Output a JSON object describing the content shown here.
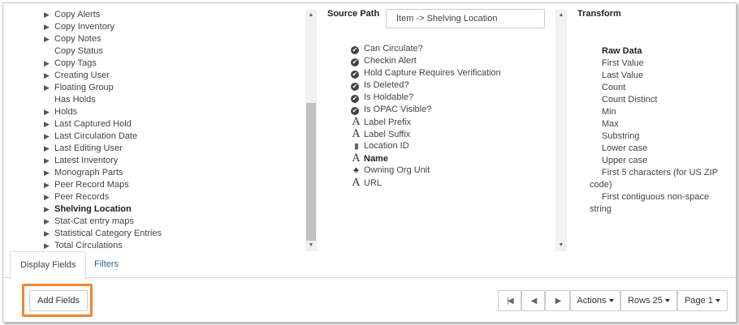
{
  "tree": {
    "items": [
      {
        "label": "Copy Alerts",
        "expandable": true
      },
      {
        "label": "Copy Inventory",
        "expandable": true
      },
      {
        "label": "Copy Notes",
        "expandable": true
      },
      {
        "label": "Copy Status",
        "expandable": false
      },
      {
        "label": "Copy Tags",
        "expandable": true
      },
      {
        "label": "Creating User",
        "expandable": true
      },
      {
        "label": "Floating Group",
        "expandable": true
      },
      {
        "label": "Has Holds",
        "expandable": false
      },
      {
        "label": "Holds",
        "expandable": true
      },
      {
        "label": "Last Captured Hold",
        "expandable": true
      },
      {
        "label": "Last Circulation Date",
        "expandable": true
      },
      {
        "label": "Last Editing User",
        "expandable": true
      },
      {
        "label": "Latest Inventory",
        "expandable": true
      },
      {
        "label": "Monograph Parts",
        "expandable": true
      },
      {
        "label": "Peer Record Maps",
        "expandable": true
      },
      {
        "label": "Peer Records",
        "expandable": true
      },
      {
        "label": "Shelving Location",
        "expandable": true,
        "selected": true
      },
      {
        "label": "Stat-Cat entry maps",
        "expandable": true
      },
      {
        "label": "Statistical Category Entries",
        "expandable": true
      },
      {
        "label": "Total Circulations",
        "expandable": true
      }
    ]
  },
  "source_path": {
    "title": "Source Path",
    "value": "Item -> Shelving Location",
    "fields": [
      {
        "label": "Can Circulate?",
        "icon": "check-circle-icon"
      },
      {
        "label": "Checkin Alert",
        "icon": "check-circle-icon"
      },
      {
        "label": "Hold Capture Requires Verification",
        "icon": "check-circle-icon"
      },
      {
        "label": "Is Deleted?",
        "icon": "check-circle-icon"
      },
      {
        "label": "Is Holdable?",
        "icon": "check-circle-icon"
      },
      {
        "label": "Is OPAC Visible?",
        "icon": "check-circle-icon"
      },
      {
        "label": "Label Prefix",
        "icon": "text-icon"
      },
      {
        "label": "Label Suffix",
        "icon": "text-icon"
      },
      {
        "label": "Location ID",
        "icon": "barcode-icon"
      },
      {
        "label": "Name",
        "icon": "text-icon",
        "selected": true
      },
      {
        "label": "Owning Org Unit",
        "icon": "tree-icon"
      },
      {
        "label": "URL",
        "icon": "text-icon"
      }
    ]
  },
  "transform": {
    "title": "Transform",
    "items": [
      {
        "label": "Raw Data",
        "selected": true
      },
      {
        "label": "First Value"
      },
      {
        "label": "Last Value"
      },
      {
        "label": "Count"
      },
      {
        "label": "Count Distinct"
      },
      {
        "label": "Min"
      },
      {
        "label": "Max"
      },
      {
        "label": "Substring"
      },
      {
        "label": "Lower case"
      },
      {
        "label": "Upper case"
      },
      {
        "label": "First 5 characters (for US ZIP",
        "cont": "code)"
      },
      {
        "label": "First contiguous non-space",
        "cont": "string"
      }
    ]
  },
  "tabs": [
    {
      "label": "Display Fields",
      "active": true
    },
    {
      "label": "Filters",
      "active": false
    }
  ],
  "buttons": {
    "add_fields": "Add Fields",
    "actions": "Actions",
    "rows": "Rows 25",
    "page": "Page 1"
  },
  "colors": {
    "highlight": "#f0882e",
    "link": "#2a6496"
  }
}
